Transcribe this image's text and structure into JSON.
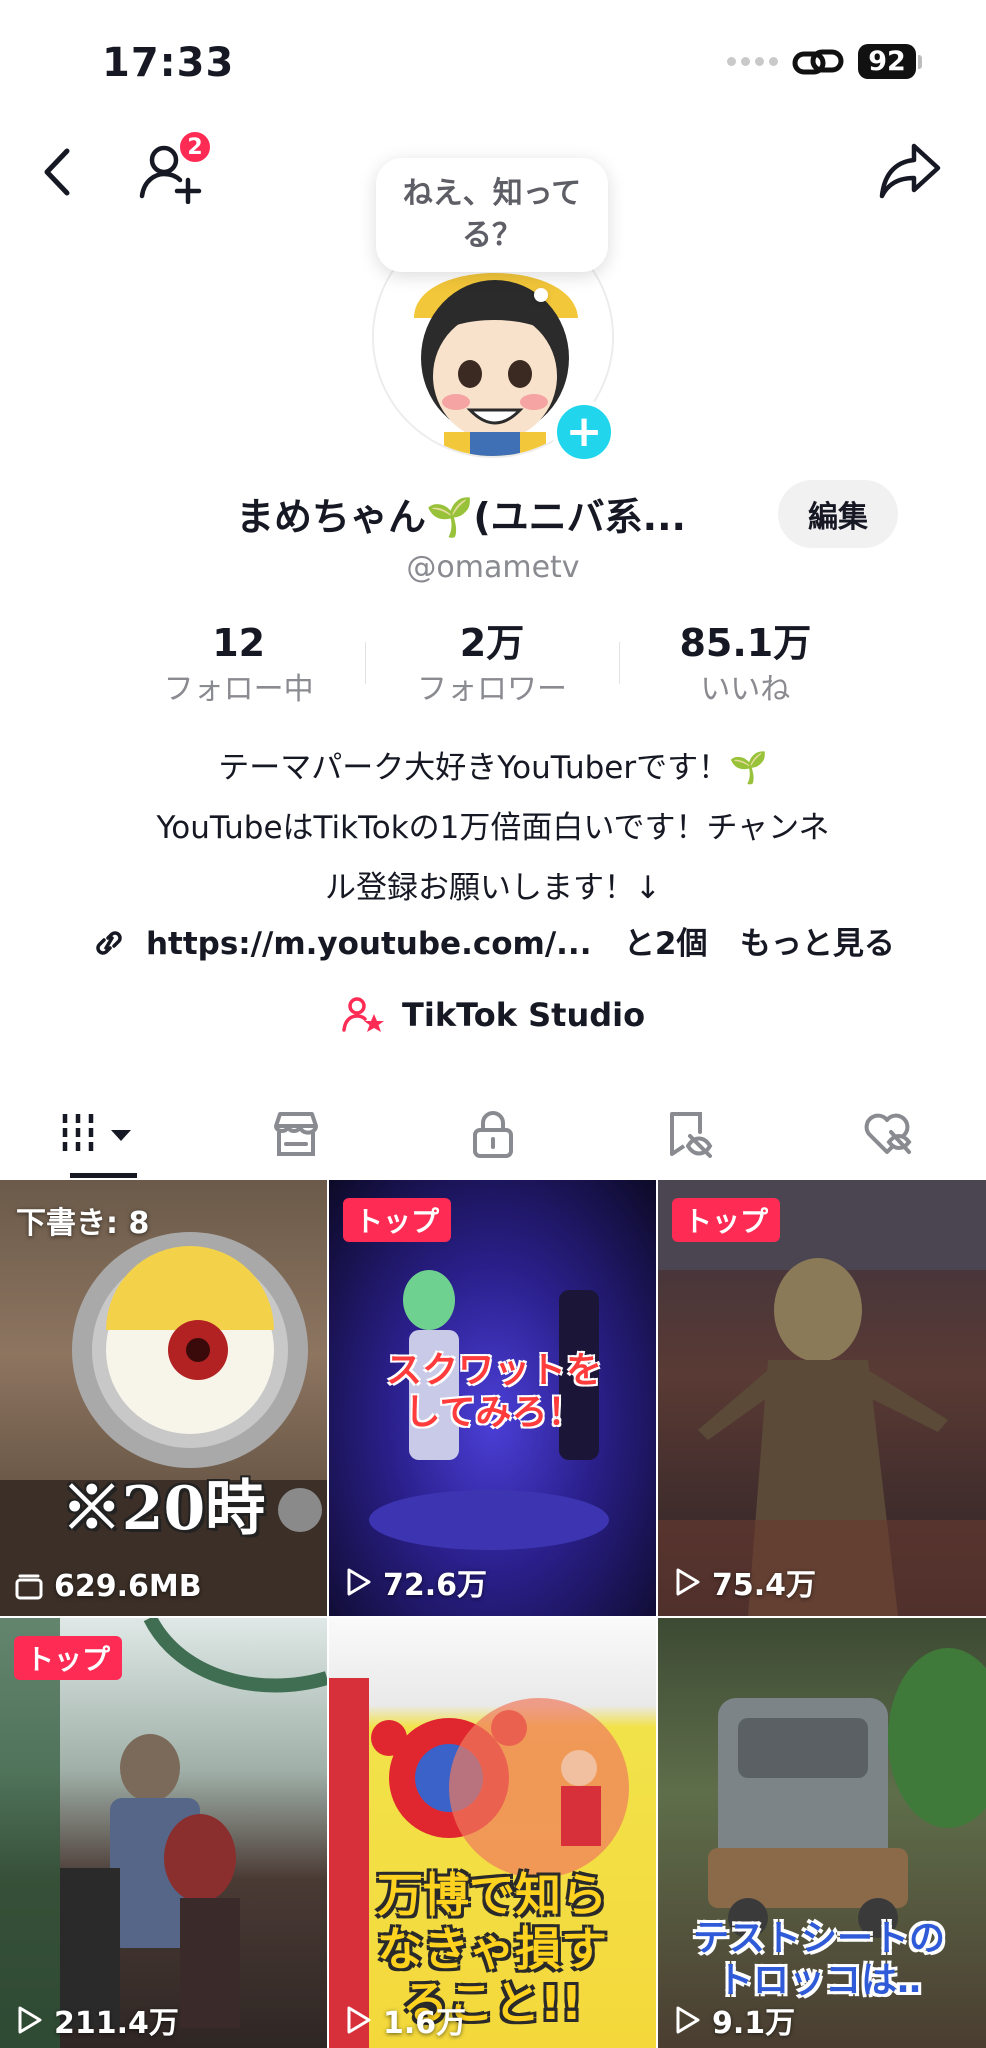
{
  "status_bar": {
    "time": "17:33",
    "battery": "92"
  },
  "nav": {
    "follow_requests_count": "2"
  },
  "profile": {
    "bubble_text": "ねえ、知ってる？",
    "display_name": "まめちゃん🌱(ユニバ系...",
    "edit_label": "編集",
    "handle": "@omametv"
  },
  "stats": [
    {
      "value": "12",
      "label": "フォロー中"
    },
    {
      "value": "2万",
      "label": "フォロワー"
    },
    {
      "value": "85.1万",
      "label": "いいね"
    }
  ],
  "bio": {
    "line1": "テーマパーク大好きYouTuberです！🌱",
    "line2": "YouTubeはTikTokの1万倍面白いです！チャンネ",
    "line3": "ル登録お願いします！↓",
    "link_text": "https://m.youtube.com/...",
    "link_more": "と2個",
    "see_more": "もっと見る"
  },
  "studio_label": "TikTok Studio",
  "tabs": [
    {
      "icon": "videos-grid-icon",
      "active": true
    },
    {
      "icon": "shop-icon",
      "active": false
    },
    {
      "icon": "private-lock-icon",
      "active": false
    },
    {
      "icon": "reposts-icon",
      "active": false
    },
    {
      "icon": "liked-heart-icon",
      "active": false
    }
  ],
  "videos": [
    {
      "label": "下書き: 8",
      "stat": "629.6MB",
      "stat_icon": "drafts-icon",
      "overlay": "※20時"
    },
    {
      "label": "トップ",
      "stat": "72.6万",
      "stat_icon": "play-icon",
      "overlay": "スクワットをしてみろ！"
    },
    {
      "label": "トップ",
      "stat": "75.4万",
      "stat_icon": "play-icon",
      "overlay": ""
    },
    {
      "label": "トップ",
      "stat": "211.4万",
      "stat_icon": "play-icon",
      "overlay": ""
    },
    {
      "label": "",
      "stat": "1.6万",
      "stat_icon": "play-icon",
      "overlay": "万博で知らなきゃ損すること!!"
    },
    {
      "label": "",
      "stat": "9.1万",
      "stat_icon": "play-icon",
      "overlay": "テストシートのトロッコは‥"
    }
  ],
  "colors": {
    "accent": "#fe2c55",
    "plus": "#20d5ec",
    "text": "#161823",
    "muted": "#8a8b91"
  }
}
